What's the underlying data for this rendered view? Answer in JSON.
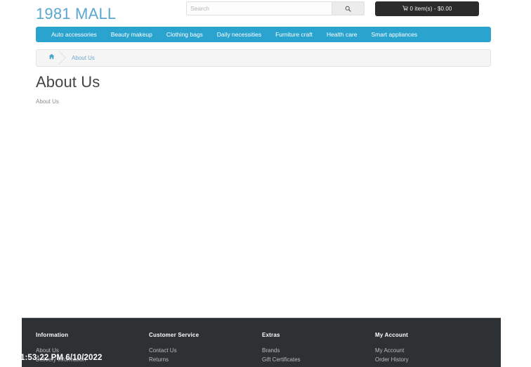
{
  "colors": {
    "logo": "#5aa7cf",
    "nav_bar": "#2aa3cf",
    "cart_button": "#2b2b2b",
    "footer_bg": "#2e3133",
    "link": "#6ca9cc"
  },
  "header": {
    "logo_text": "1981 MALL",
    "search": {
      "placeholder": "Search",
      "value": "",
      "icon": "search-icon",
      "button_label": ""
    },
    "cart": {
      "icon": "shopping-cart-icon",
      "label": "0 item(s) - $0.00"
    }
  },
  "nav": {
    "items": [
      {
        "label": "Auto accessories"
      },
      {
        "label": "Beauty makeup"
      },
      {
        "label": "Clothing bags"
      },
      {
        "label": "Daily necessities"
      },
      {
        "label": "Furniture craft"
      },
      {
        "label": "Health care"
      },
      {
        "label": "Smart appliances"
      }
    ]
  },
  "breadcrumb": {
    "home_icon": "home-icon",
    "items": [
      {
        "label": "About Us"
      }
    ]
  },
  "main": {
    "title": "About Us",
    "body": "About Us"
  },
  "footer": {
    "columns": [
      {
        "title": "Information",
        "links": [
          {
            "label": "About Us"
          },
          {
            "label": "Delivery Information"
          }
        ]
      },
      {
        "title": "Customer Service",
        "links": [
          {
            "label": "Contact Us"
          },
          {
            "label": "Returns"
          }
        ]
      },
      {
        "title": "Extras",
        "links": [
          {
            "label": "Brands"
          },
          {
            "label": "Gift Certificates"
          }
        ]
      },
      {
        "title": "My Account",
        "links": [
          {
            "label": "My Account"
          },
          {
            "label": "Order History"
          }
        ]
      }
    ]
  },
  "overlay": {
    "timestamp": "1:53:22 PM 6/10/2022"
  }
}
